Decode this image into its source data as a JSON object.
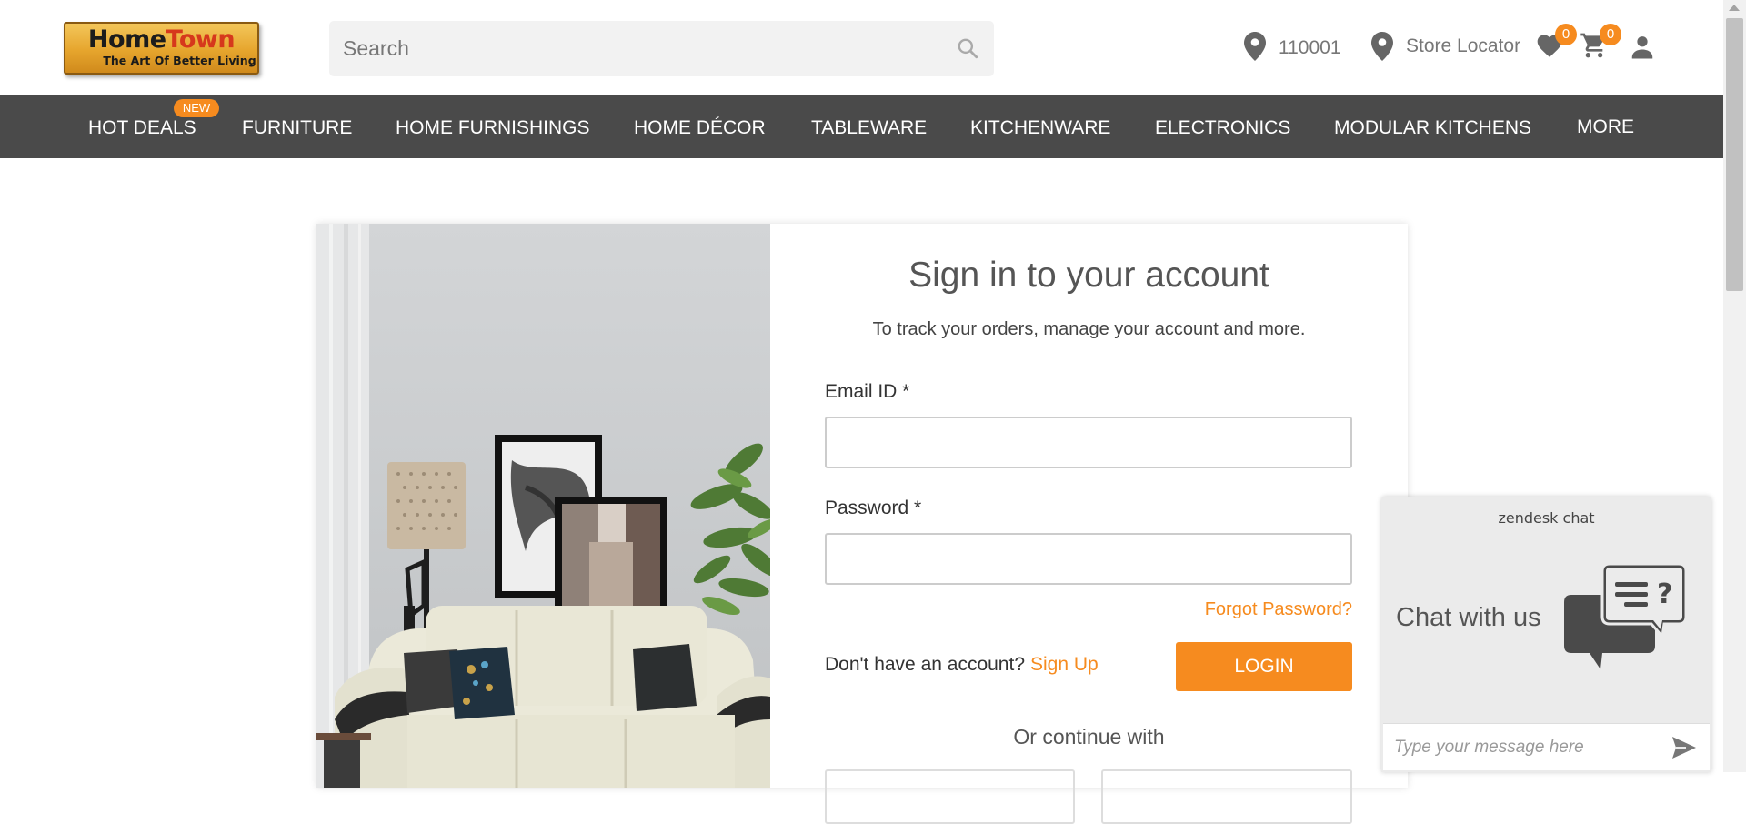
{
  "header": {
    "logo": {
      "brand_home": "Home",
      "brand_town": "Town",
      "tagline": "The Art Of Better Living"
    },
    "search": {
      "placeholder": "Search",
      "value": ""
    },
    "pincode": "110001",
    "store_locator": "Store Locator",
    "wishlist_count": "0",
    "cart_count": "0"
  },
  "nav": {
    "new_badge": "NEW",
    "items": [
      "HOT DEALS",
      "FURNITURE",
      "HOME FURNISHINGS",
      "HOME DÉCOR",
      "TABLEWARE",
      "KITCHENWARE",
      "ELECTRONICS",
      "MODULAR KITCHENS",
      "MORE"
    ]
  },
  "signin": {
    "title": "Sign in to your account",
    "subtitle": "To track your orders, manage your account and more.",
    "email_label": "Email ID *",
    "email_value": "",
    "password_label": "Password *",
    "password_value": "",
    "forgot": "Forgot Password?",
    "no_account": "Don't have an account?",
    "signup": "Sign Up",
    "login": "LOGIN",
    "or_continue": "Or continue with"
  },
  "chat": {
    "header": "zendesk chat",
    "label": "Chat with us",
    "placeholder": "Type your message here"
  },
  "colors": {
    "accent": "#f68b1f",
    "nav_bg": "#4a4a4a"
  }
}
